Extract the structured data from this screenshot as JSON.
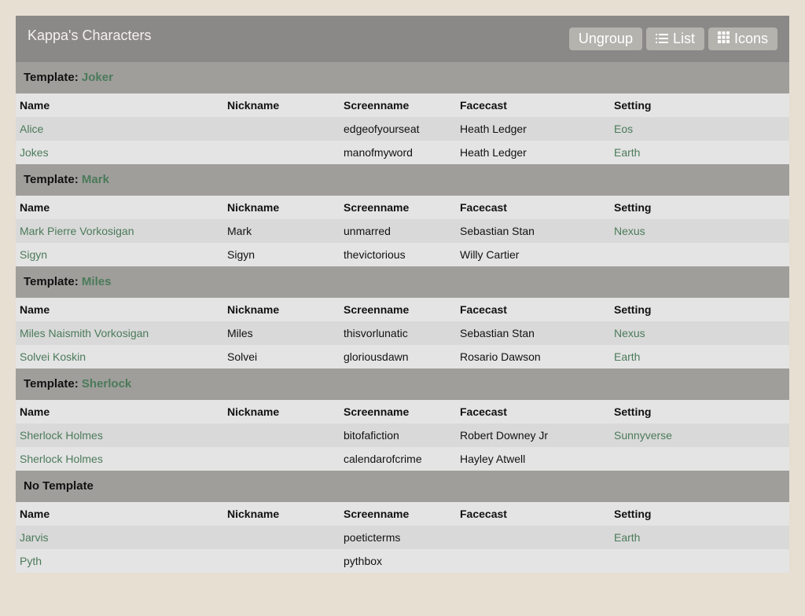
{
  "header": {
    "title": "Kappa's Characters",
    "buttons": {
      "ungroup": "Ungroup",
      "list": "List",
      "icons": "Icons"
    }
  },
  "columns": [
    "Name",
    "Nickname",
    "Screenname",
    "Facecast",
    "Setting"
  ],
  "groups": [
    {
      "prefix": "Template: ",
      "name": "Joker",
      "rows": [
        {
          "name": "Alice",
          "nickname": "",
          "screenname": "edgeofyourseat",
          "facecast": "Heath Ledger",
          "setting": "Eos"
        },
        {
          "name": "Jokes",
          "nickname": "",
          "screenname": "manofmyword",
          "facecast": "Heath Ledger",
          "setting": "Earth"
        }
      ]
    },
    {
      "prefix": "Template: ",
      "name": "Mark",
      "rows": [
        {
          "name": "Mark Pierre Vorkosigan",
          "nickname": "Mark",
          "screenname": "unmarred",
          "facecast": "Sebastian Stan",
          "setting": "Nexus"
        },
        {
          "name": "Sigyn",
          "nickname": "Sigyn",
          "screenname": "thevictorious",
          "facecast": "Willy Cartier",
          "setting": ""
        }
      ]
    },
    {
      "prefix": "Template: ",
      "name": "Miles",
      "rows": [
        {
          "name": "Miles Naismith Vorkosigan",
          "nickname": "Miles",
          "screenname": "thisvorlunatic",
          "facecast": "Sebastian Stan",
          "setting": "Nexus"
        },
        {
          "name": "Solvei Koskin",
          "nickname": "Solvei",
          "screenname": "gloriousdawn",
          "facecast": "Rosario Dawson",
          "setting": "Earth"
        }
      ]
    },
    {
      "prefix": "Template: ",
      "name": "Sherlock",
      "rows": [
        {
          "name": "Sherlock Holmes",
          "nickname": "",
          "screenname": "bitofafiction",
          "facecast": "Robert Downey Jr",
          "setting": "Sunnyverse"
        },
        {
          "name": "Sherlock Holmes",
          "nickname": "",
          "screenname": "calendarofcrime",
          "facecast": "Hayley Atwell",
          "setting": ""
        }
      ]
    },
    {
      "prefix": "No Template",
      "name": "",
      "rows": [
        {
          "name": "Jarvis",
          "nickname": "",
          "screenname": "poeticterms",
          "facecast": "",
          "setting": "Earth"
        },
        {
          "name": "Pyth",
          "nickname": "",
          "screenname": "pythbox",
          "facecast": "",
          "setting": ""
        }
      ]
    }
  ],
  "colors": {
    "accent": "#4b7a5a",
    "header_bg": "#8b8888",
    "group_bg": "#9f9e9b",
    "page_bg": "#e6dfd2"
  },
  "icons": {
    "list": "list-icon",
    "icons": "grid-icon"
  }
}
